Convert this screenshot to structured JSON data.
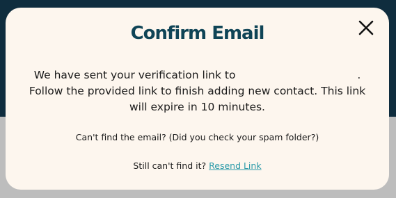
{
  "modal": {
    "title": "Confirm Email",
    "message_line1_prefix": "We have sent your verification link to",
    "message_line1_suffix": ".",
    "message_rest": "Follow the provided link to finish adding new contact. This link will expire in 10 minutes.",
    "spam_note": "Can't find the email? (Did you check your spam folder?)",
    "still_cant_find": "Still can't find it?",
    "resend_link": "Resend Link",
    "close_icon": "close-icon"
  },
  "colors": {
    "title": "#0f4456",
    "link": "#2a9aa8",
    "modal_bg": "#fdf6ee",
    "backdrop_dark": "#0f2d3e",
    "backdrop_gray": "#bdbdbd"
  }
}
